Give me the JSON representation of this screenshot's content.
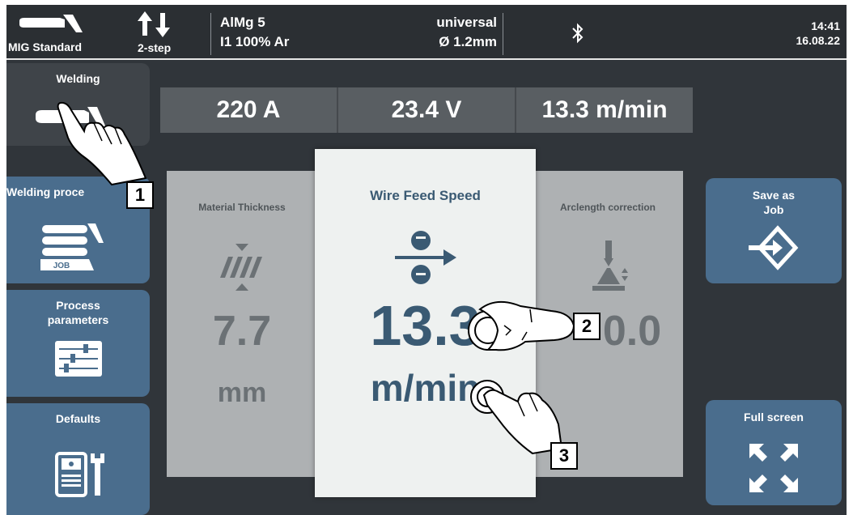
{
  "header": {
    "mode": "MIG Standard",
    "trigger_mode": "2-step",
    "material": "AlMg 5",
    "gas": "I1 100% Ar",
    "wire_type": "universal",
    "wire_diameter": "Ø 1.2mm",
    "time": "14:41",
    "date": "16.08.22",
    "icons": [
      "welding-torch-icon",
      "up-down-arrows-icon",
      "bluetooth-icon"
    ]
  },
  "sidebar": {
    "items": [
      {
        "label": "Welding",
        "icon": "welding-torch-icon"
      },
      {
        "label": "Welding proce",
        "icon": "welding-process-job-icon",
        "badge": "JOB"
      },
      {
        "label": "Process\nparameters",
        "icon": "sliders-icon"
      },
      {
        "label": "Defaults",
        "icon": "power-source-wrench-icon"
      }
    ]
  },
  "readouts": {
    "current": "220 A",
    "voltage": "23.4 V",
    "wire_speed": "13.3 m/min"
  },
  "params": {
    "material_thickness": {
      "title": "Material Thickness",
      "value": "7.7",
      "unit": "mm",
      "icon": "material-thickness-icon"
    },
    "wire_feed_speed": {
      "title": "Wire Feed Speed",
      "value": "13.3",
      "unit": "m/min",
      "icon": "wire-feed-icon"
    },
    "arclength": {
      "title": "Arclength correction",
      "value": "0.0",
      "icon": "arclength-icon"
    }
  },
  "right_buttons": {
    "save_as_job": "Save as\nJob",
    "full_screen": "Full screen"
  },
  "callouts": [
    "1",
    "2",
    "3"
  ],
  "colors": {
    "background": "#30353a",
    "accent_blue": "#4a6d8d",
    "selected_panel": "#eef1f0",
    "inactive_panel": "#aeb1b3",
    "wfs_value": "#3a5a73"
  }
}
